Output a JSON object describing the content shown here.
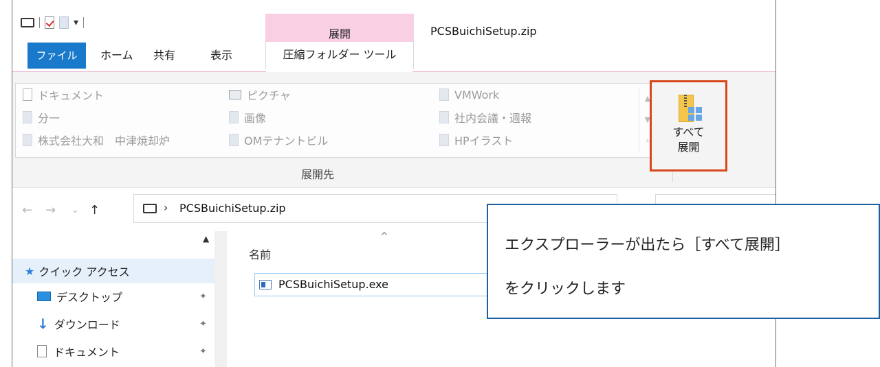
{
  "window": {
    "title": "PCSBuichiSetup.zip",
    "context_header": "展開"
  },
  "tabs": {
    "file": "ファイル",
    "home": "ホーム",
    "share": "共有",
    "view": "表示",
    "compressed_tools": "圧縮フォルダー ツール"
  },
  "ribbon": {
    "destinations": [
      {
        "label": "ドキュメント",
        "icon": "document-icon"
      },
      {
        "label": "分一",
        "icon": "folder-icon"
      },
      {
        "label": "株式会社大和　中津焼却炉",
        "icon": "folder-icon"
      },
      {
        "label": "ピクチャ",
        "icon": "pictures-icon"
      },
      {
        "label": "画像",
        "icon": "folder-icon"
      },
      {
        "label": "OMテナントビル",
        "icon": "folder-icon"
      },
      {
        "label": "VMWork",
        "icon": "folder-icon"
      },
      {
        "label": "社内会議・週報",
        "icon": "folder-icon"
      },
      {
        "label": "HPイラスト",
        "icon": "folder-icon"
      }
    ],
    "group_label": "展開先",
    "extract_all_line1": "すべて",
    "extract_all_line2": "展開"
  },
  "address": {
    "path": "PCSBuichiSetup.zip"
  },
  "sidebar": {
    "items": [
      {
        "label": "クイック アクセス",
        "icon": "star-icon",
        "pinned": false
      },
      {
        "label": "デスクトップ",
        "icon": "desktop-icon",
        "pinned": true
      },
      {
        "label": "ダウンロード",
        "icon": "download-icon",
        "pinned": true
      },
      {
        "label": "ドキュメント",
        "icon": "document-icon",
        "pinned": true
      }
    ]
  },
  "filelist": {
    "column_name": "名前",
    "files": [
      {
        "name": "PCSBuichiSetup.exe",
        "icon": "exe-icon"
      }
    ]
  },
  "callout": {
    "line1": "エクスプローラーが出たら［すべて展開］",
    "line2": "をクリックします"
  },
  "colors": {
    "file_tab": "#1979ca",
    "context_tab": "#f9cfe3",
    "highlight": "#d6471c",
    "callout_border": "#1b5fa5"
  }
}
